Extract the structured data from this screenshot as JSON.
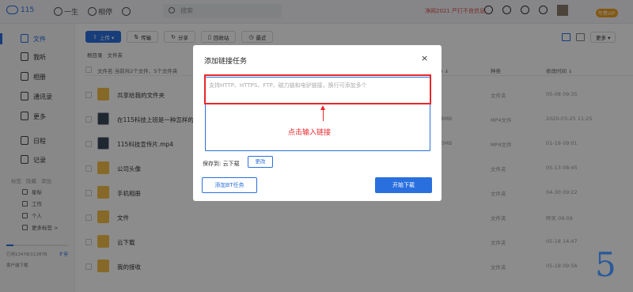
{
  "topbar": {
    "logo_text": "115",
    "nav": [
      "一生",
      "相停"
    ],
    "search_placeholder": "搜索",
    "promo_text": "净网2021 严打不良信息",
    "vip_badge": "年费VIP"
  },
  "sidebar": {
    "items": [
      {
        "label": "文件",
        "icon": "file-icon",
        "active": true
      },
      {
        "label": "我听",
        "icon": "headphones-icon"
      },
      {
        "label": "相册",
        "icon": "photo-icon"
      },
      {
        "label": "通讯录",
        "icon": "contacts-icon"
      },
      {
        "label": "更多",
        "icon": "more-icon"
      },
      {
        "label": "日程",
        "icon": "calendar-icon"
      },
      {
        "label": "记录",
        "icon": "pen-icon"
      }
    ],
    "tag_labels": [
      "标签",
      "隐藏",
      "添加"
    ],
    "tags": [
      {
        "label": "星标",
        "icon": "star-icon"
      },
      {
        "label": "工作",
        "icon": "bag-icon"
      },
      {
        "label": "个人",
        "icon": "person-icon"
      },
      {
        "label": "更多标签 >",
        "icon": "tag-icon"
      }
    ],
    "storage_text": "已用13478/11287B",
    "storage_fraction": 0.12,
    "expand_label": "扩容",
    "client_label": "客户端下载"
  },
  "toolbar": {
    "upload": "上传 ▾",
    "transfer": "传输",
    "share": "分享",
    "recycle": "回收站",
    "recent": "最近",
    "more": "更多 ▾"
  },
  "breadcrumb": {
    "root": "根目录",
    "current": "文件夹"
  },
  "list": {
    "header_name": "文件名   当前共2个文件、5个文件夹",
    "header_size": "小 ↓",
    "header_type": "种类",
    "header_time": "修改时间 ↓",
    "rows": [
      {
        "name": "共享给我的文件夹",
        "size": "",
        "type": "文件夹",
        "time": "05-08 09:35",
        "kind": "folder"
      },
      {
        "name": "在115科技上班是一种怎样的体",
        "size": "58MB",
        "type": "MP4文件",
        "time": "2020-03-25 11:25",
        "kind": "video"
      },
      {
        "name": "115科技宣传片.mp4",
        "size": "40MB",
        "type": "MP4文件",
        "time": "01-19 09:01",
        "kind": "video"
      },
      {
        "name": "公司头像",
        "size": "",
        "type": "文件夹",
        "time": "05-13 08:45",
        "kind": "folder"
      },
      {
        "name": "手机相册",
        "size": "",
        "type": "文件夹",
        "time": "04-30 09:22",
        "kind": "folder"
      },
      {
        "name": "文件",
        "size": "",
        "type": "文件夹",
        "time": "昨天 09:09",
        "kind": "folder"
      },
      {
        "name": "云下载",
        "size": "",
        "type": "文件夹",
        "time": "05-18 14:47",
        "kind": "folder"
      },
      {
        "name": "我的接收",
        "size": "",
        "type": "文件夹",
        "time": "05-18 09:56",
        "kind": "folder"
      }
    ]
  },
  "dialog": {
    "title": "添加链接任务",
    "close": "×",
    "placeholder": "支持HTTP、HTTPS、FTP、磁力链和电驴链接，换行可添加多个",
    "hint": "点击输入链接",
    "save_to": "保存到:  云下载",
    "change_btn": "更改",
    "bt_btn": "添加BT任务",
    "start_btn": "开始下载"
  },
  "step_number": "5",
  "colors": {
    "accent": "#2a6fde",
    "annotation": "#e8262b",
    "folder": "#f5c04a"
  }
}
